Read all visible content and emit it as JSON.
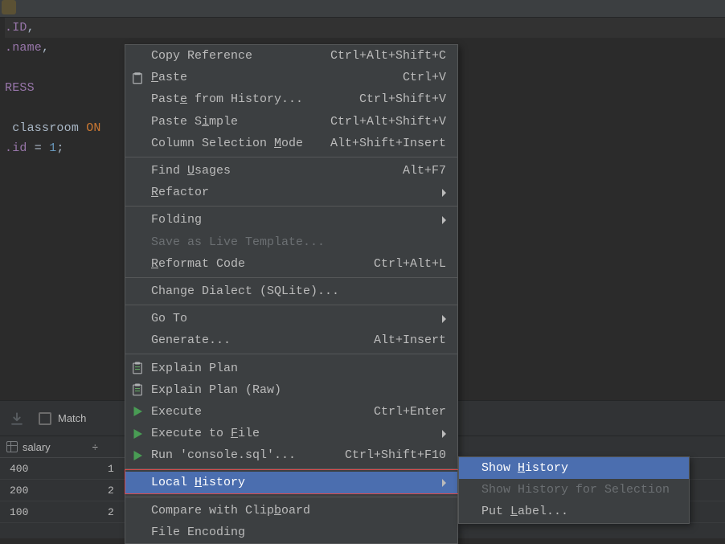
{
  "editor": {
    "lines": [
      {
        "segments": [
          {
            "t": "ident",
            "v": ".ID"
          },
          {
            "t": "txt",
            "v": ","
          }
        ],
        "hl": true
      },
      {
        "segments": [
          {
            "t": "ident",
            "v": ".name"
          },
          {
            "t": "txt",
            "v": ","
          }
        ]
      },
      {
        "segments": []
      },
      {
        "segments": [
          {
            "t": "ident",
            "v": "RESS"
          }
        ]
      },
      {
        "segments": []
      },
      {
        "segments": [
          {
            "t": "txt",
            "v": " classroom "
          },
          {
            "t": "kw",
            "v": "ON"
          }
        ]
      },
      {
        "segments": [
          {
            "t": "ident",
            "v": ".id"
          },
          {
            "t": "txt",
            "v": " = "
          },
          {
            "t": "num",
            "v": "1"
          },
          {
            "t": "txt",
            "v": ";"
          }
        ]
      }
    ]
  },
  "bottom_panel": {
    "match_label": "Match",
    "column_header": "salary",
    "sort_glyph": "÷",
    "rows": [
      {
        "c1": "400",
        "c2": "1"
      },
      {
        "c1": "200",
        "c2": "2"
      },
      {
        "c1": "100",
        "c2": "2"
      }
    ]
  },
  "context_menu": {
    "items": [
      {
        "id": "copy-reference",
        "label": "Copy Reference",
        "shortcut": "Ctrl+Alt+Shift+C"
      },
      {
        "id": "paste",
        "label_html": "<u>P</u>aste",
        "shortcut": "Ctrl+V",
        "icon": "paste"
      },
      {
        "id": "paste-history",
        "label_html": "Past<u>e</u> from History...",
        "shortcut": "Ctrl+Shift+V"
      },
      {
        "id": "paste-simple",
        "label_html": "Paste S<u>i</u>mple",
        "shortcut": "Ctrl+Alt+Shift+V"
      },
      {
        "id": "column-selection",
        "label_html": "Column Selection <u>M</u>ode",
        "shortcut": "Alt+Shift+Insert"
      },
      {
        "sep": true
      },
      {
        "id": "find-usages",
        "label_html": "Find <u>U</u>sages",
        "shortcut": "Alt+F7"
      },
      {
        "id": "refactor",
        "label_html": "<u>R</u>efactor",
        "submenu": true
      },
      {
        "sep": true
      },
      {
        "id": "folding",
        "label": "Folding",
        "submenu": true
      },
      {
        "id": "save-live-template",
        "label": "Save as Live Template...",
        "disabled": true
      },
      {
        "id": "reformat",
        "label_html": "<u>R</u>eformat Code",
        "shortcut": "Ctrl+Alt+L"
      },
      {
        "sep": true
      },
      {
        "id": "change-dialect",
        "label": "Change Dialect (SQLite)..."
      },
      {
        "sep": true
      },
      {
        "id": "go-to",
        "label": "Go To",
        "submenu": true
      },
      {
        "id": "generate",
        "label": "Generate...",
        "shortcut": "Alt+Insert"
      },
      {
        "sep": true
      },
      {
        "id": "explain-plan",
        "label": "Explain Plan",
        "icon": "clip"
      },
      {
        "id": "explain-plan-raw",
        "label": "Explain Plan (Raw)",
        "icon": "clip"
      },
      {
        "id": "execute",
        "label": "Execute",
        "shortcut": "Ctrl+Enter",
        "icon": "exec"
      },
      {
        "id": "execute-to-file",
        "label_html": "Execute to <u>F</u>ile",
        "submenu": true,
        "icon": "exec"
      },
      {
        "id": "run-console",
        "label": "Run 'console.sql'...",
        "shortcut": "Ctrl+Shift+F10",
        "icon": "exec"
      },
      {
        "sep": true
      },
      {
        "id": "local-history",
        "label_html": "Local <u>H</u>istory",
        "submenu": true,
        "highlight": true,
        "redbox": true
      },
      {
        "sep": true
      },
      {
        "id": "compare-clipboard",
        "label_html": "Compare with Clip<u>b</u>oard"
      },
      {
        "id": "file-encoding",
        "label": "File Encoding"
      }
    ]
  },
  "submenu": {
    "items": [
      {
        "id": "show-history",
        "label_html": "Show <u>H</u>istory",
        "highlight": true
      },
      {
        "id": "show-history-selection",
        "label": "Show History for Selection",
        "disabled": true
      },
      {
        "id": "put-label",
        "label_html": "Put <u>L</u>abel..."
      }
    ]
  }
}
